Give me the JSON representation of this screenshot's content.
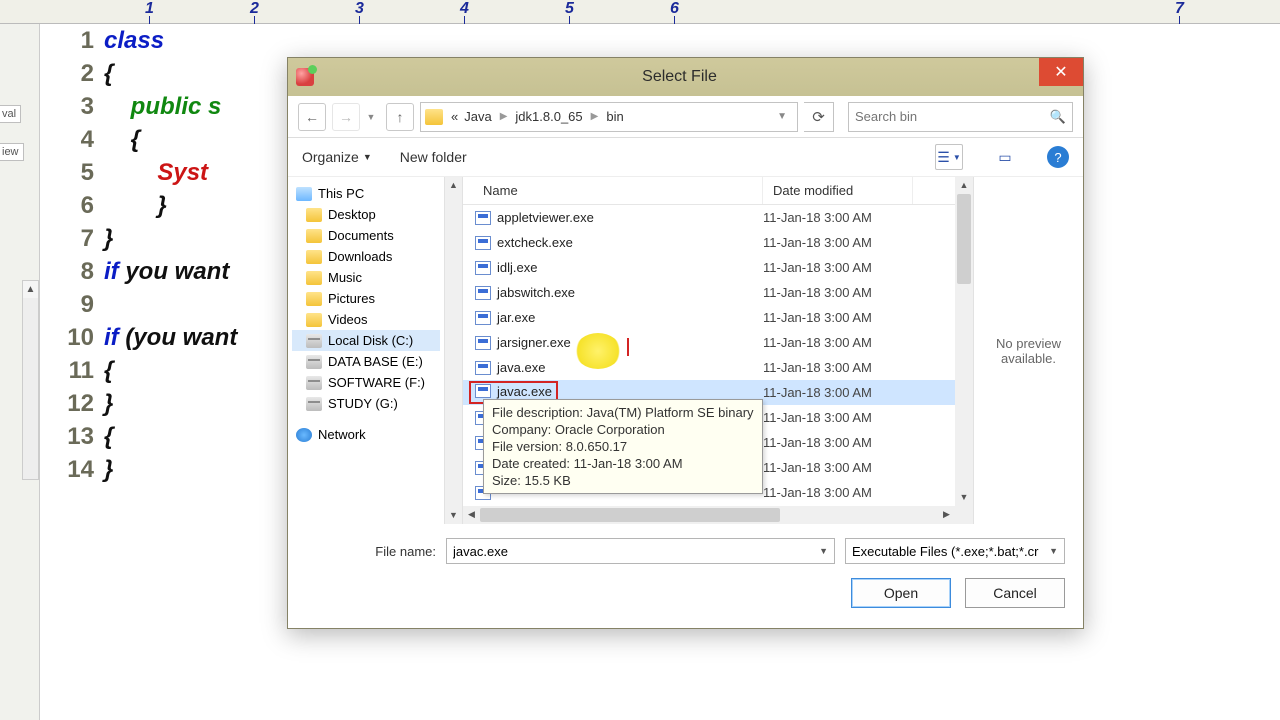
{
  "editor": {
    "ruler_numbers": [
      "1",
      "2",
      "3",
      "4",
      "5",
      "6",
      "7"
    ],
    "line_numbers": [
      "1",
      "2",
      "3",
      "4",
      "5",
      "6",
      "7",
      "8",
      "9",
      "10",
      "11",
      "12",
      "13",
      "14"
    ],
    "code_lines": [
      {
        "t": "class",
        "c": "kw-blue"
      },
      {
        "t": "{",
        "c": "kw-black",
        "fold": true
      },
      {
        "t": "    public s",
        "c": "kw-green"
      },
      {
        "t": "    {",
        "c": "kw-black",
        "fold": true
      },
      {
        "t": "        Syst",
        "c": "kw-red"
      },
      {
        "t": "        }",
        "c": "kw-black"
      },
      {
        "t": "}",
        "c": "kw-black"
      },
      {
        "t": "if you want",
        "c": "kw-mixed"
      },
      {
        "t": "",
        "c": ""
      },
      {
        "t": "if (you want",
        "c": "kw-mixed"
      },
      {
        "t": "{",
        "c": "kw-black"
      },
      {
        "t": "}",
        "c": "kw-black"
      },
      {
        "t": "{",
        "c": "kw-black"
      },
      {
        "t": "}",
        "c": "kw-black"
      }
    ],
    "sidepanel_tabs": [
      "val",
      "iew"
    ]
  },
  "dialog": {
    "title": "Select File",
    "breadcrumb": {
      "prefix": "«",
      "segs": [
        "Java",
        "jdk1.8.0_65",
        "bin"
      ]
    },
    "search_placeholder": "Search bin",
    "organize": "Organize",
    "new_folder": "New folder",
    "tree": {
      "this_pc": "This PC",
      "items": [
        "Desktop",
        "Documents",
        "Downloads",
        "Music",
        "Pictures",
        "Videos"
      ],
      "drives": [
        "Local Disk (C:)",
        "DATA BASE (E:)",
        "SOFTWARE (F:)",
        "STUDY (G:)"
      ],
      "selected_drive_index": 0,
      "network": "Network"
    },
    "columns": {
      "name": "Name",
      "date": "Date modified"
    },
    "files": [
      {
        "n": "appletviewer.exe",
        "d": "11-Jan-18 3:00 AM"
      },
      {
        "n": "extcheck.exe",
        "d": "11-Jan-18 3:00 AM"
      },
      {
        "n": "idlj.exe",
        "d": "11-Jan-18 3:00 AM"
      },
      {
        "n": "jabswitch.exe",
        "d": "11-Jan-18 3:00 AM"
      },
      {
        "n": "jar.exe",
        "d": "11-Jan-18 3:00 AM"
      },
      {
        "n": "jarsigner.exe",
        "d": "11-Jan-18 3:00 AM"
      },
      {
        "n": "java.exe",
        "d": "11-Jan-18 3:00 AM"
      },
      {
        "n": "javac.exe",
        "d": "11-Jan-18 3:00 AM",
        "sel": true
      },
      {
        "n": "",
        "d": "11-Jan-18 3:00 AM"
      },
      {
        "n": "",
        "d": "11-Jan-18 3:00 AM"
      },
      {
        "n": "",
        "d": "11-Jan-18 3:00 AM"
      },
      {
        "n": "",
        "d": "11-Jan-18 3:00 AM"
      }
    ],
    "tooltip": {
      "l1": "File description: Java(TM) Platform SE binary",
      "l2": "Company: Oracle Corporation",
      "l3": "File version: 8.0.650.17",
      "l4": "Date created: 11-Jan-18 3:00 AM",
      "l5": "Size: 15.5 KB"
    },
    "preview": "No preview available.",
    "filename_label": "File name:",
    "filename_value": "javac.exe",
    "filter_text": "Executable Files (*.exe;*.bat;*.cr",
    "open": "Open",
    "cancel": "Cancel"
  }
}
